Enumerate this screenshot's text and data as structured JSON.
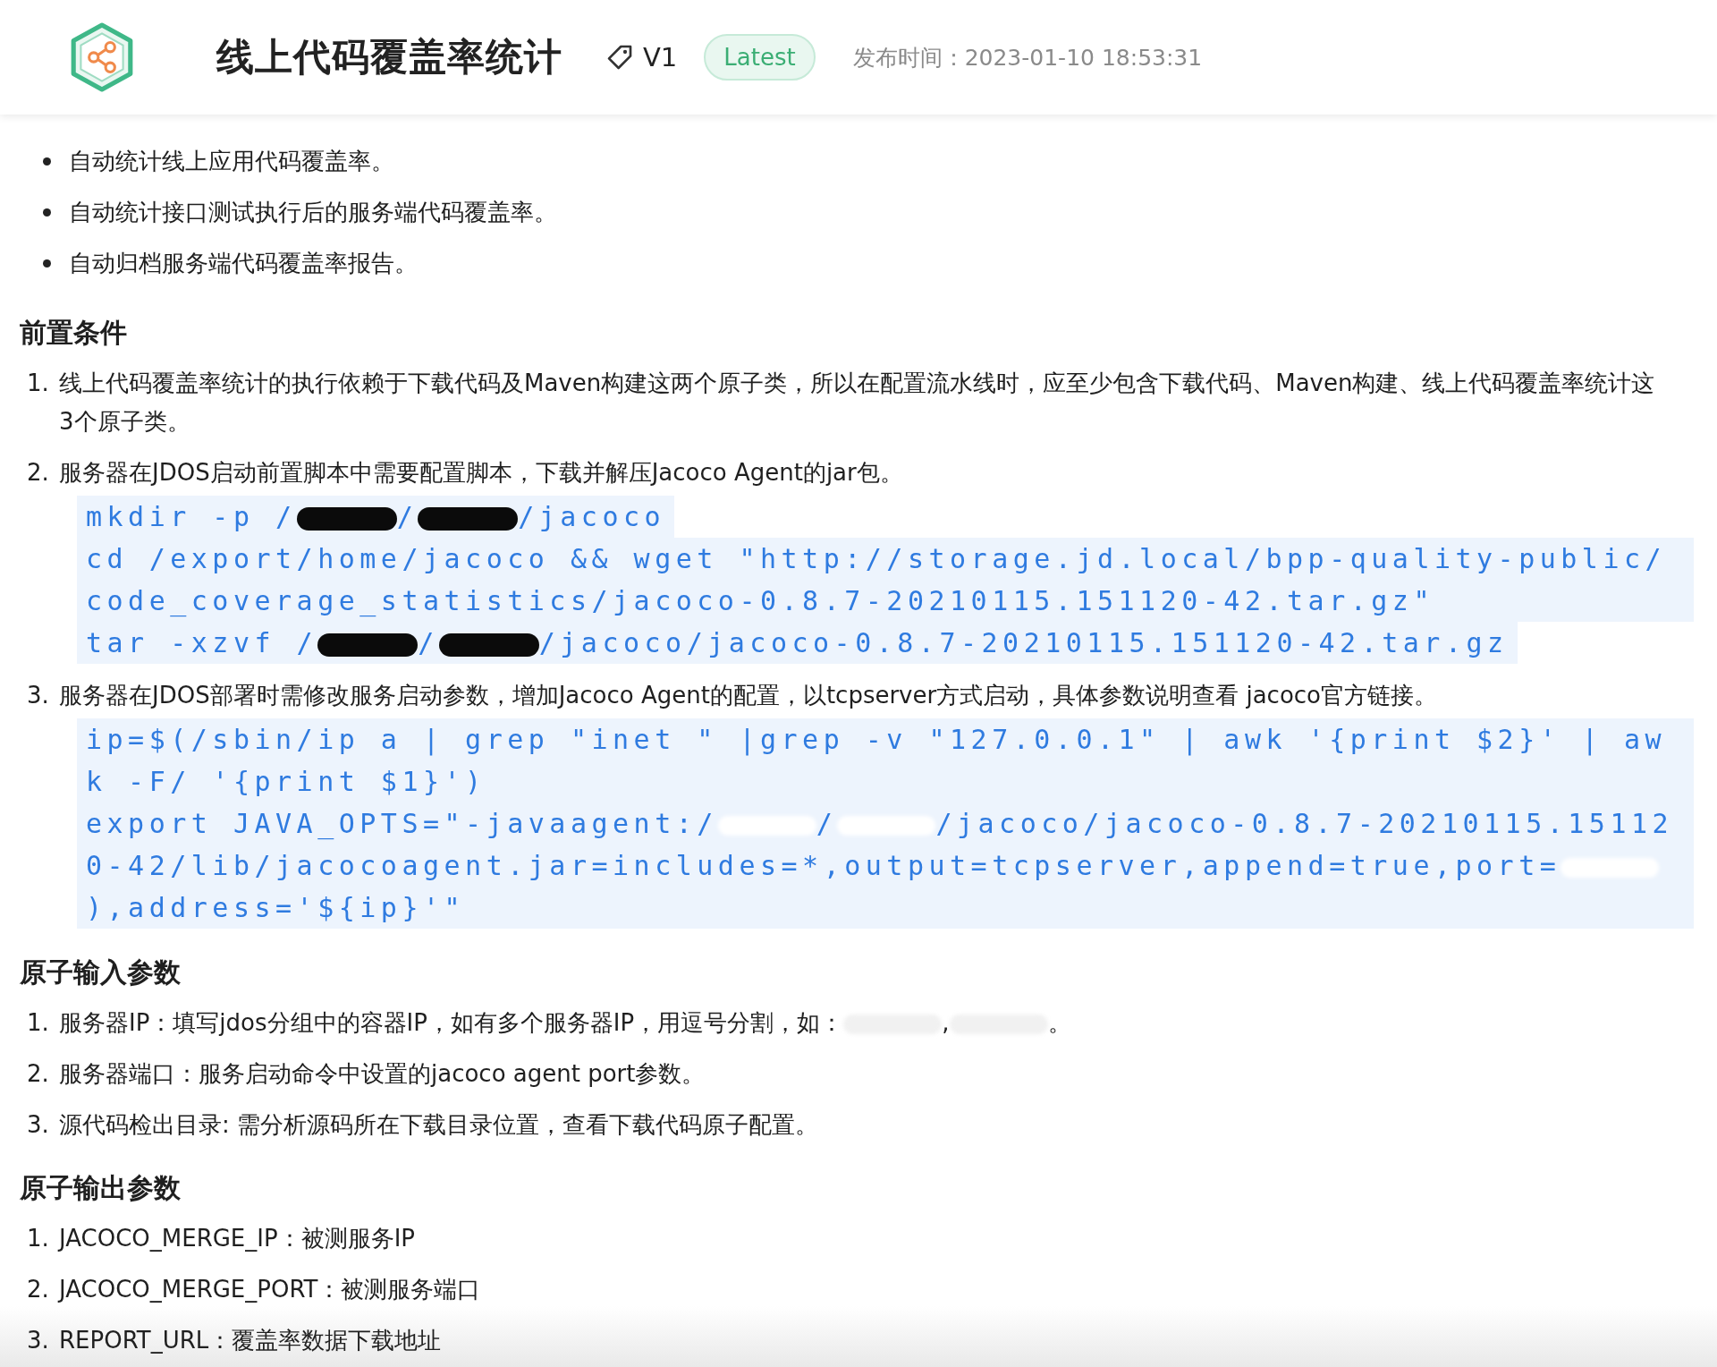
{
  "header": {
    "title": "线上代码覆盖率统计",
    "version": "V1",
    "badge": "Latest",
    "publish_time": "发布时间：2023-01-10 18:53:31"
  },
  "features": [
    "自动统计线上应用代码覆盖率。",
    "自动统计接口测试执行后的服务端代码覆盖率。",
    "自动归档服务端代码覆盖率报告。"
  ],
  "sections": [
    {
      "heading": "前置条件",
      "items": [
        {
          "number": "1.",
          "text": "线上代码覆盖率统计的执行依赖于下载代码及Maven构建这两个原子类，所以在配置流水线时，应至少包含下载代码、Maven构建、线上代码覆盖率统计这3个原子类。"
        },
        {
          "number": "2.",
          "text": "服务器在JDOS启动前置脚本中需要配置脚本，下载并解压Jacoco Agent的jar包。",
          "code": [
            [
              {
                "kind": "text",
                "text": "mkdir -p /"
              },
              {
                "kind": "redacted-dark"
              },
              {
                "kind": "text",
                "text": "/"
              },
              {
                "kind": "redacted-dark"
              },
              {
                "kind": "text",
                "text": "/jacoco"
              }
            ],
            [
              {
                "kind": "text",
                "text": "cd /export/home/jacoco && wget \"http://storage.jd.local/bpp-quality-public/code_coverage_statistics/jacoco-0.8.7-20210115.151120-42.tar.gz\""
              }
            ],
            [
              {
                "kind": "text",
                "text": "tar -xzvf /"
              },
              {
                "kind": "redacted-dark"
              },
              {
                "kind": "text",
                "text": "/"
              },
              {
                "kind": "redacted-dark"
              },
              {
                "kind": "text",
                "text": "/jacoco/jacoco-0.8.7-20210115.151120-42.tar.gz"
              }
            ]
          ]
        },
        {
          "number": "3.",
          "text": "服务器在JDOS部署时需修改服务启动参数，增加Jacoco Agent的配置，以tcpserver方式启动，具体参数说明查看 jacoco官方链接。",
          "code": [
            [
              {
                "kind": "text",
                "text": "ip=$(/sbin/ip a | grep \"inet \" |grep -v \"127.0.0.1\" | awk '{print $2}' | awk -F/ '{print $1}')"
              }
            ],
            [
              {
                "kind": "text",
                "text": "export JAVA_OPTS=\"-javaagent:/"
              },
              {
                "kind": "redacted-light"
              },
              {
                "kind": "text",
                "text": "/"
              },
              {
                "kind": "redacted-light"
              },
              {
                "kind": "text",
                "text": "/jacoco/jacoco-0.8.7-20210115.151120-42/lib/jacocoagent.jar=includes=*,output=tcpserver,append=true,port="
              },
              {
                "kind": "redacted-light"
              },
              {
                "kind": "text",
                "text": "),address='${ip}'\""
              }
            ]
          ]
        }
      ]
    },
    {
      "heading": "原子输入参数",
      "items": [
        {
          "number": "1.",
          "parts": [
            {
              "kind": "text",
              "text": "服务器IP：填写jdos分组中的容器IP，如有多个服务器IP，用逗号分割，如："
            },
            {
              "kind": "redacted-light"
            },
            {
              "kind": "text",
              "text": ","
            },
            {
              "kind": "redacted-light"
            },
            {
              "kind": "text",
              "text": "。"
            }
          ]
        },
        {
          "number": "2.",
          "text": "服务器端口：服务启动命令中设置的jacoco agent port参数。"
        },
        {
          "number": "3.",
          "text": "源代码检出目录: 需分析源码所在下载目录位置，查看下载代码原子配置。"
        }
      ]
    },
    {
      "heading": "原子输出参数",
      "items": [
        {
          "number": "1.",
          "text": "JACOCO_MERGE_IP：被测服务IP"
        },
        {
          "number": "2.",
          "text": "JACOCO_MERGE_PORT：被测服务端口"
        },
        {
          "number": "3.",
          "text": "REPORT_URL：覆盖率数据下载地址"
        }
      ]
    }
  ]
}
